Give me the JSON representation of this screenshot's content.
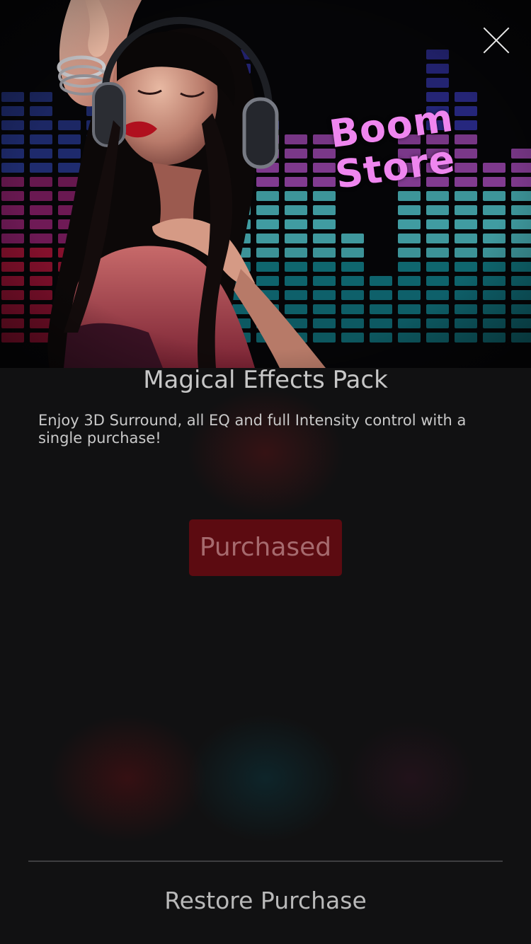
{
  "hero": {
    "close_icon": "close-icon",
    "logo_line1": "Boom",
    "logo_line2": "Store",
    "image": "woman-with-headphones-equalizer-background"
  },
  "product": {
    "title": "Magical Effects Pack",
    "description": "Enjoy 3D Surround, all EQ and full Intensity control with a single purchase!",
    "button_label": "Purchased"
  },
  "footer": {
    "restore_label": "Restore Purchase"
  },
  "colors": {
    "background": "#111112",
    "button": "#5c0b11",
    "logo": "#ef86ef"
  }
}
